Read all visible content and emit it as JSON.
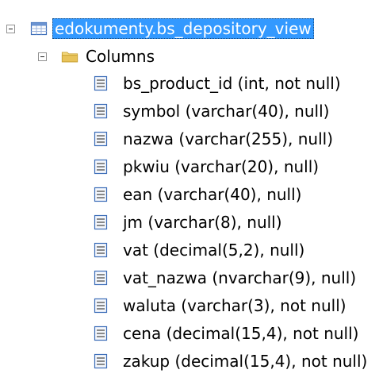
{
  "tree": {
    "view_node": {
      "label": "edokumenty.bs_depository_view",
      "icon": "view-table-icon",
      "expanded": true,
      "selected": true
    },
    "columns_folder": {
      "label": "Columns",
      "icon": "folder-icon",
      "expanded": true
    },
    "columns": [
      {
        "label": "bs_product_id (int, not null)",
        "icon": "column-icon"
      },
      {
        "label": "symbol (varchar(40), null)",
        "icon": "column-icon"
      },
      {
        "label": "nazwa (varchar(255), null)",
        "icon": "column-icon"
      },
      {
        "label": "pkwiu (varchar(20), null)",
        "icon": "column-icon"
      },
      {
        "label": "ean (varchar(40), null)",
        "icon": "column-icon"
      },
      {
        "label": "jm (varchar(8), null)",
        "icon": "column-icon"
      },
      {
        "label": "vat (decimal(5,2), null)",
        "icon": "column-icon"
      },
      {
        "label": "vat_nazwa (nvarchar(9), null)",
        "icon": "column-icon"
      },
      {
        "label": "waluta (varchar(3), not null)",
        "icon": "column-icon"
      },
      {
        "label": "cena (decimal(15,4), not null)",
        "icon": "column-icon"
      },
      {
        "label": "zakup (decimal(15,4), not null)",
        "icon": "column-icon"
      }
    ]
  },
  "colors": {
    "selection": "#3399ff",
    "selection_text": "#ffffff",
    "folder": "#e8c35a",
    "icon_blue": "#3b6cb7"
  }
}
